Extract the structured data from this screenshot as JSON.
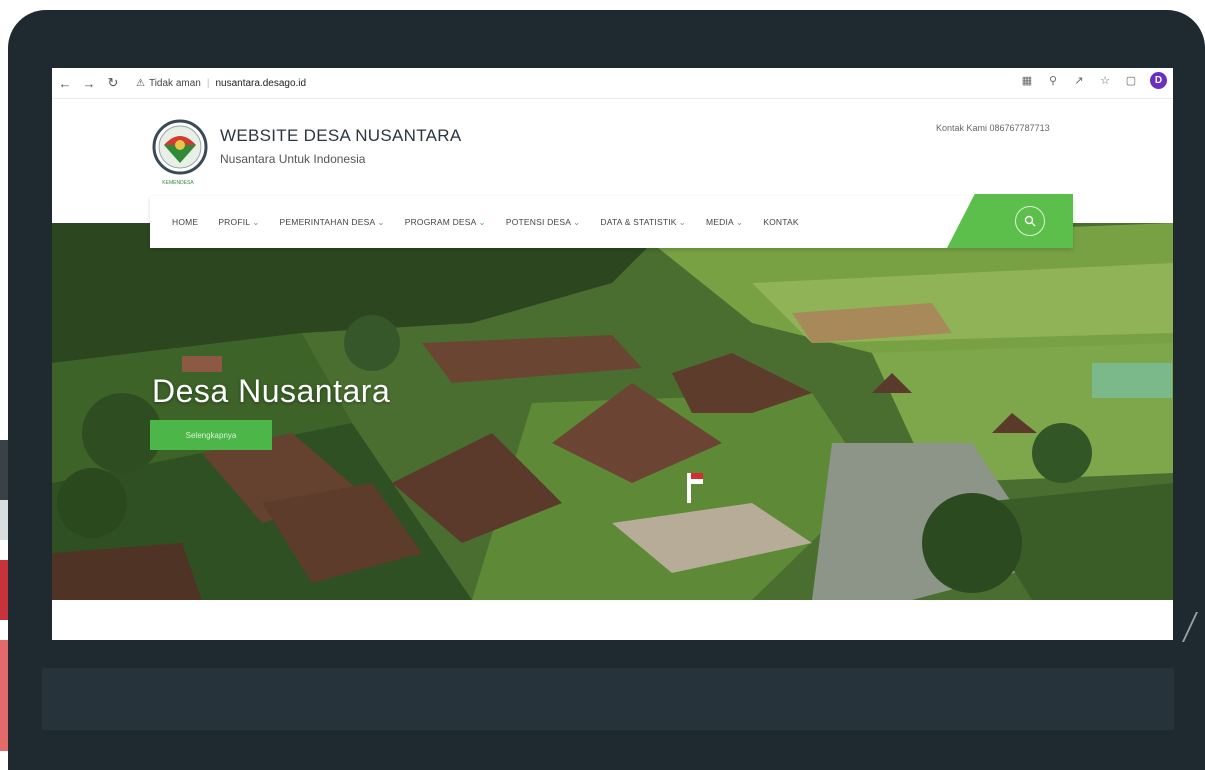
{
  "browser": {
    "security_label": "Tidak aman",
    "url": "nusantara.desago.id",
    "profile_initial": "D",
    "colors": {
      "profile": "#6a2fc1"
    }
  },
  "site": {
    "title": "WEBSITE DESA NUSANTARA",
    "tagline": "Nusantara Untuk Indonesia",
    "contact": "Kontak Kami 086767787713",
    "logo_caption": "KEMENDESA"
  },
  "nav": {
    "items": [
      {
        "label": "HOME",
        "has_dropdown": false
      },
      {
        "label": "PROFIL",
        "has_dropdown": true
      },
      {
        "label": "PEMERINTAHAN DESA",
        "has_dropdown": true
      },
      {
        "label": "PROGRAM DESA",
        "has_dropdown": true
      },
      {
        "label": "POTENSI DESA",
        "has_dropdown": true
      },
      {
        "label": "DATA & STATISTIK",
        "has_dropdown": true
      },
      {
        "label": "MEDIA",
        "has_dropdown": true
      },
      {
        "label": "KONTAK",
        "has_dropdown": false
      }
    ],
    "search_icon": "search-icon",
    "colors": {
      "accent": "#5cbf4b"
    }
  },
  "hero": {
    "title": "Desa Nusantara",
    "button_label": "Selengkapnya",
    "colors": {
      "button": "#4cb648"
    }
  }
}
